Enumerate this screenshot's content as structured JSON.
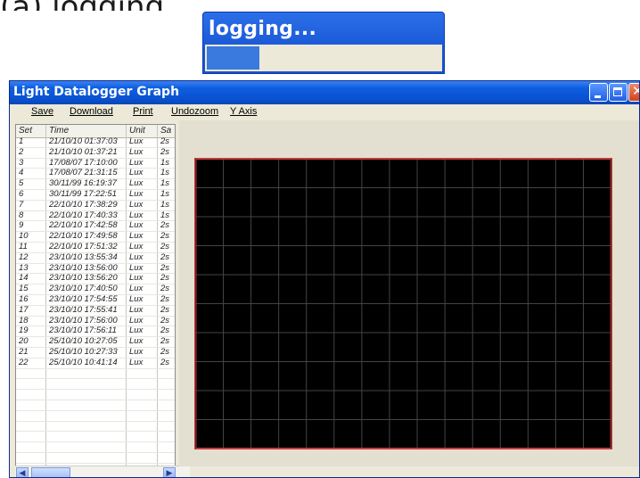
{
  "top_crop_text": "(a)   logging",
  "logging_dialog": {
    "title": "logging...",
    "progress": 0.22
  },
  "window": {
    "title": "Light Datalogger Graph"
  },
  "menu": {
    "items": [
      {
        "name": "menu-save",
        "label": "Save"
      },
      {
        "name": "menu-download",
        "label": "Download"
      },
      {
        "name": "menu-print",
        "label": "Print"
      },
      {
        "name": "menu-undozoom",
        "label": "Undozoom"
      },
      {
        "name": "menu-y-axis",
        "label": "Y Axis"
      }
    ]
  },
  "table": {
    "headers": [
      "Set",
      "Time",
      "Unit",
      "Sa"
    ],
    "rows": [
      [
        "1",
        "21/10/10 01:37:03",
        "Lux",
        "2s"
      ],
      [
        "2",
        "21/10/10 01:37:21",
        "Lux",
        "2s"
      ],
      [
        "3",
        "17/08/07 17:10:00",
        "Lux",
        "1s"
      ],
      [
        "4",
        "17/08/07 21:31:15",
        "Lux",
        "1s"
      ],
      [
        "5",
        "30/11/99 16:19:37",
        "Lux",
        "1s"
      ],
      [
        "6",
        "30/11/99 17:22:51",
        "Lux",
        "1s"
      ],
      [
        "7",
        "22/10/10 17:38:29",
        "Lux",
        "1s"
      ],
      [
        "8",
        "22/10/10 17:40:33",
        "Lux",
        "1s"
      ],
      [
        "9",
        "22/10/10 17:42:58",
        "Lux",
        "2s"
      ],
      [
        "10",
        "22/10/10 17:49:58",
        "Lux",
        "2s"
      ],
      [
        "11",
        "22/10/10 17:51:32",
        "Lux",
        "2s"
      ],
      [
        "12",
        "23/10/10 13:55:34",
        "Lux",
        "2s"
      ],
      [
        "13",
        "23/10/10 13:56:00",
        "Lux",
        "2s"
      ],
      [
        "14",
        "23/10/10 13:56:20",
        "Lux",
        "2s"
      ],
      [
        "15",
        "23/10/10 17:40:50",
        "Lux",
        "2s"
      ],
      [
        "16",
        "23/10/10 17:54:55",
        "Lux",
        "2s"
      ],
      [
        "17",
        "23/10/10 17:55:41",
        "Lux",
        "2s"
      ],
      [
        "18",
        "23/10/10 17:56:00",
        "Lux",
        "2s"
      ],
      [
        "19",
        "23/10/10 17:56:11",
        "Lux",
        "2s"
      ],
      [
        "20",
        "25/10/10 10:27:05",
        "Lux",
        "2s"
      ],
      [
        "21",
        "25/10/10 10:27:33",
        "Lux",
        "2s"
      ],
      [
        "22",
        "25/10/10 10:41:14",
        "Lux",
        "2s"
      ]
    ]
  },
  "graph": {
    "background": "#000000",
    "grid_color": "#444444",
    "border_color": "#c43c3c",
    "grid_columns": 15,
    "grid_rows": 10
  }
}
